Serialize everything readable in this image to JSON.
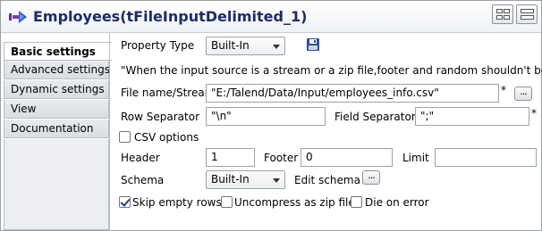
{
  "window": {
    "title": "Employees(tFileInputDelimited_1)",
    "title_icon": "component-arrow-icon"
  },
  "sidebar": {
    "items": [
      {
        "label": "Basic settings",
        "active": true
      },
      {
        "label": "Advanced settings",
        "active": false
      },
      {
        "label": "Dynamic settings",
        "active": false
      },
      {
        "label": "View",
        "active": false
      },
      {
        "label": "Documentation",
        "active": false
      }
    ]
  },
  "form": {
    "property_type_label": "Property Type",
    "property_type_value": "Built-In",
    "save_icon": "floppy-disk-icon",
    "note": "\"When the input source is a stream or a zip file,footer and random shouldn't be bigger than",
    "filename_label": "File name/Stream",
    "filename_value": "\"E:/Talend/Data/Input/employees_info.csv\"",
    "filename_star": "*",
    "filename_browse": "...",
    "row_sep_label": "Row Separator",
    "row_sep_value": "\"\\n\"",
    "field_sep_label": "Field Separator",
    "field_sep_value": "\";\"",
    "field_sep_star": "*",
    "csv_options_label": "CSV options",
    "header_label": "Header",
    "header_value": "1",
    "footer_label": "Footer",
    "footer_value": "0",
    "limit_label": "Limit",
    "limit_value": "",
    "schema_label": "Schema",
    "schema_value": "Built-In",
    "edit_schema_label": "Edit schema",
    "edit_schema_button": "...",
    "skip_empty_label": "Skip empty rows",
    "uncompress_label": "Uncompress as zip file",
    "die_on_error_label": "Die on error"
  },
  "colors": {
    "title_text": "#1b2b6a",
    "accent_blue": "#1f3f8f"
  }
}
